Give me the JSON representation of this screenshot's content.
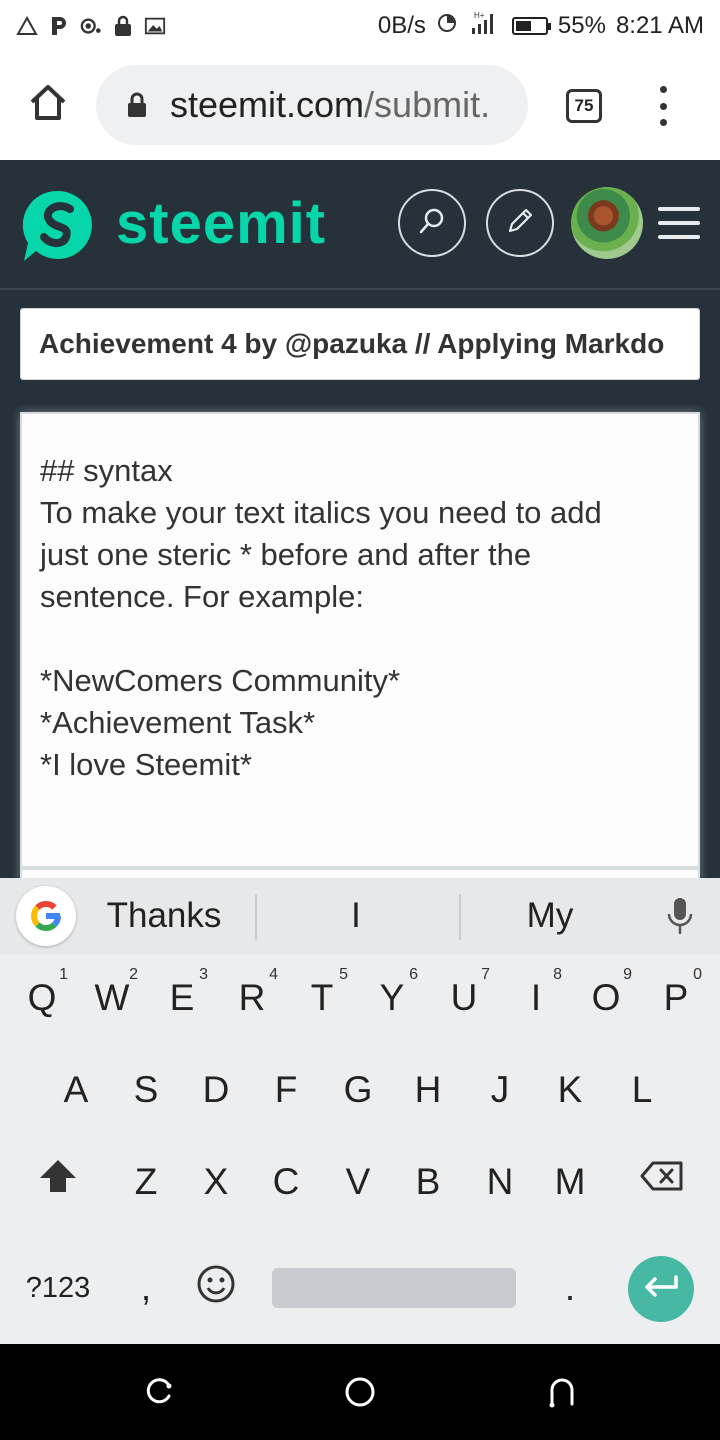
{
  "status_bar": {
    "net_speed": "0B/s",
    "signal": "H+",
    "battery_percent": "55%",
    "battery_level": 0.55,
    "time": "8:21 AM",
    "icons": [
      "triangle-alert-icon",
      "p-app-icon",
      "recorder-icon",
      "lock-notif-icon",
      "image-notif-icon",
      "data-saver-icon",
      "signal-icon",
      "battery-icon"
    ]
  },
  "browser": {
    "url_domain": "steemit.com",
    "url_path": "/submit.",
    "tab_count": "75"
  },
  "site": {
    "name": "steemit",
    "brand_color": "#07d6aa",
    "header_bg": "#26313a"
  },
  "editor": {
    "title_value": "Achievement 4 by  @pazuka // Applying Markdo",
    "body_lines": [
      "## syntax",
      "To make your text italics you need to add",
      "just one steric * before and after the",
      "sentence. For example:",
      "",
      "*NewComers Community*",
      "*Achievement Task*",
      "*I love Steemit*"
    ]
  },
  "keyboard": {
    "suggestions": [
      "Thanks",
      "I",
      "My"
    ],
    "row1": [
      {
        "key": "Q",
        "hint": "1"
      },
      {
        "key": "W",
        "hint": "2"
      },
      {
        "key": "E",
        "hint": "3"
      },
      {
        "key": "R",
        "hint": "4"
      },
      {
        "key": "T",
        "hint": "5"
      },
      {
        "key": "Y",
        "hint": "6"
      },
      {
        "key": "U",
        "hint": "7"
      },
      {
        "key": "I",
        "hint": "8"
      },
      {
        "key": "O",
        "hint": "9"
      },
      {
        "key": "P",
        "hint": "0"
      }
    ],
    "row2": [
      "A",
      "S",
      "D",
      "F",
      "G",
      "H",
      "J",
      "K",
      "L"
    ],
    "row3": [
      "Z",
      "X",
      "C",
      "V",
      "B",
      "N",
      "M"
    ],
    "symbols_label": "?123",
    "comma": ",",
    "period": ".",
    "enter_color": "#46b8a3"
  }
}
